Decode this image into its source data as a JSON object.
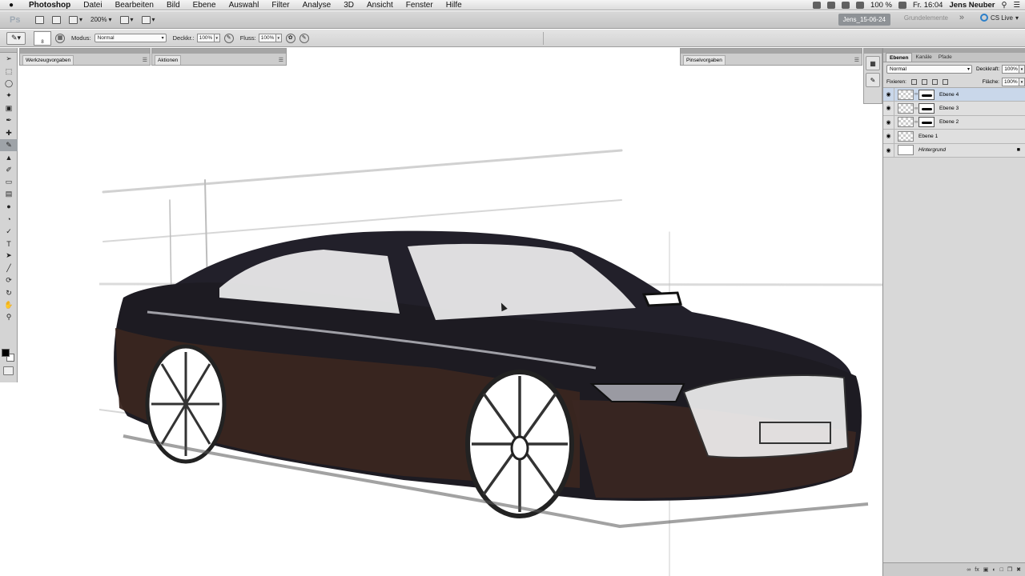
{
  "menubar": {
    "app": "Photoshop",
    "items": [
      "Datei",
      "Bearbeiten",
      "Bild",
      "Ebene",
      "Auswahl",
      "Filter",
      "Analyse",
      "3D",
      "Ansicht",
      "Fenster",
      "Hilfe"
    ],
    "battery": "100 %",
    "clock": "Fr. 16:04",
    "user": "Jens Neuber"
  },
  "appbar": {
    "logo": "Ps",
    "zoom": "200%",
    "workspace_chip": "Jens_15-06-24",
    "workspace_label": "Grundelemente",
    "more": "»",
    "cslive": "CS Live"
  },
  "options": {
    "brush_size": "8",
    "mode_label": "Modus:",
    "mode_value": "Normal",
    "opacity_label": "Deckkr.:",
    "opacity_value": "100%",
    "flow_label": "Fluss:",
    "flow_value": "100%"
  },
  "panels": {
    "werkzeug": "Werkzeugvorgaben",
    "aktionen": "Aktionen",
    "pinsel": "Pinselvorgaben"
  },
  "layers_panel": {
    "tabs": [
      "Ebenen",
      "Kanäle",
      "Pfade"
    ],
    "blend_mode": "Normal",
    "opacity_label": "Deckkraft:",
    "opacity_value": "100%",
    "lock_label": "Fixieren:",
    "fill_label": "Fläche:",
    "fill_value": "100%",
    "layers": [
      {
        "name": "Ebene 4",
        "selected": true
      },
      {
        "name": "Ebene 3",
        "selected": false
      },
      {
        "name": "Ebene 2",
        "selected": false
      },
      {
        "name": "Ebene 1",
        "selected": false
      },
      {
        "name": "Hintergrund",
        "selected": false
      }
    ]
  },
  "colors": {
    "car_body": "#1d1b22",
    "car_lower": "#3a2620",
    "selection": "#c9d7ea"
  }
}
